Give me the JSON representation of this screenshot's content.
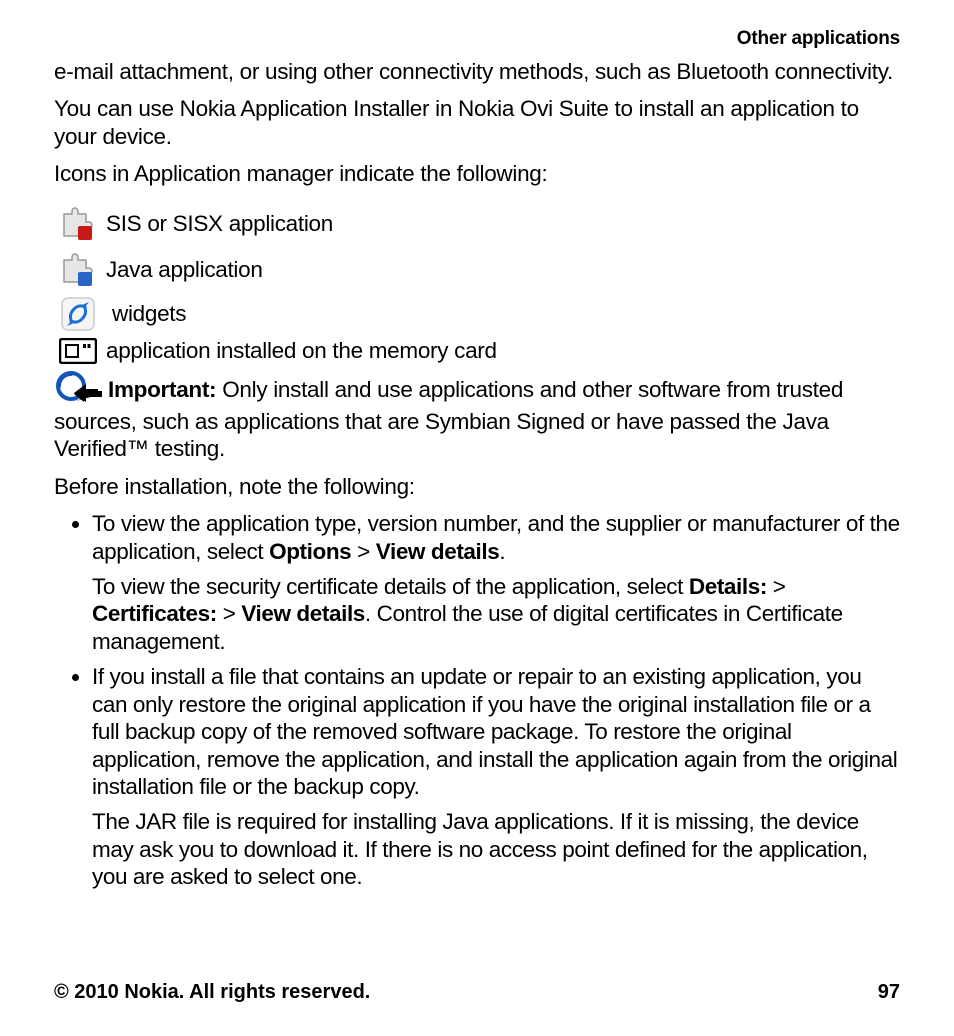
{
  "header": "Other applications",
  "para1": "e-mail attachment, or using other connectivity methods, such as Bluetooth connectivity.",
  "para2": "You can use Nokia Application Installer in Nokia Ovi Suite to install an application to your device.",
  "para3": "Icons in Application manager indicate the following:",
  "icons": {
    "sis": "SIS or SISX application",
    "java": "Java application",
    "widgets": "widgets",
    "memcard": "application installed on the memory card"
  },
  "important_label": "Important:",
  "important_text": " Only install and use applications and other software from trusted sources, such as applications that are Symbian Signed or have passed the Java Verified™ testing.",
  "para4": "Before installation, note the following:",
  "bullet1_a": "To view the application type, version number, and the supplier or manufacturer of the application, select ",
  "bullet1_b": "Options",
  "bullet1_c": " > ",
  "bullet1_d": "View details",
  "bullet1_e": ".",
  "bullet1p2_a": "To view the security certificate details of the application, select ",
  "bullet1p2_b": "Details:",
  "bullet1p2_c": " > ",
  "bullet1p2_d": "Certificates:",
  "bullet1p2_e": " > ",
  "bullet1p2_f": "View details",
  "bullet1p2_g": ". Control the use of digital certificates in Certificate management.",
  "bullet2_a": "If you install a file that contains an update or repair to an existing application, you can only restore the original application if you have the original installation file or a full backup copy of the removed software package. To restore the original application, remove the application, and install the application again from the original installation file or the backup copy.",
  "bullet2p2": "The JAR file is required for installing Java applications. If it is missing, the device may ask you to download it. If there is no access point defined for the application, you are asked to select one.",
  "footer_left": "© 2010 Nokia. All rights reserved.",
  "footer_right": "97"
}
